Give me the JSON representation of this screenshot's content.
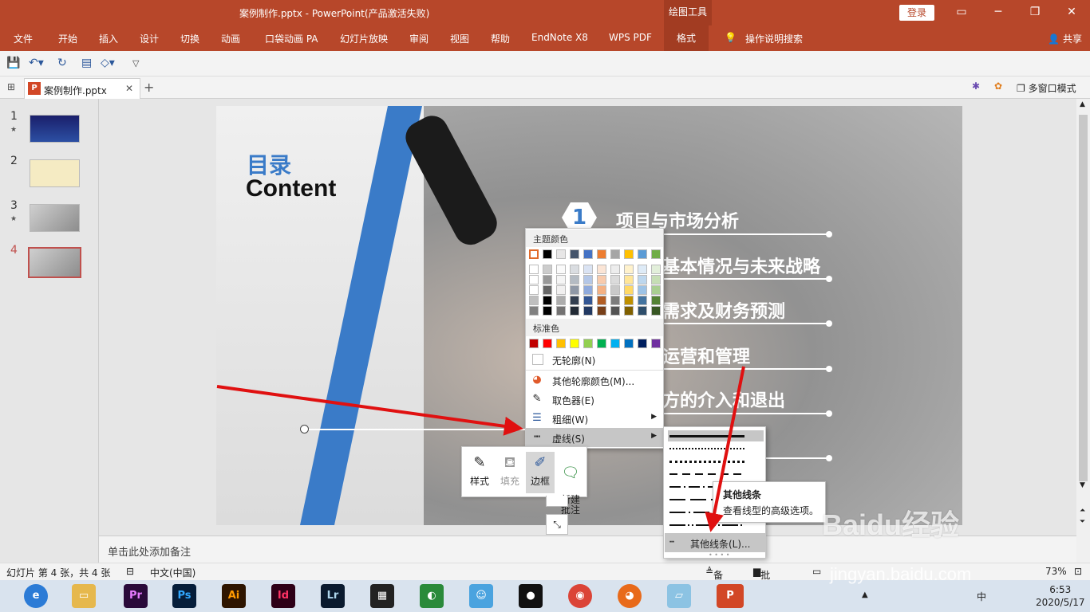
{
  "window": {
    "title": "案例制作.pptx  -  PowerPoint(产品激活失败)",
    "context_tab": "绘图工具",
    "login": "登录",
    "min_icon": "minimize-icon",
    "max_icon": "restore-icon",
    "close_icon": "close-icon"
  },
  "ribbon": {
    "tabs": [
      "文件",
      "开始",
      "插入",
      "设计",
      "切换",
      "动画",
      "口袋动画 PA",
      "幻灯片放映",
      "审阅",
      "视图",
      "帮助",
      "EndNote X8",
      "WPS PDF",
      "格式"
    ],
    "active_tab": "格式",
    "search": "操作说明搜索",
    "share": "共享"
  },
  "doc": {
    "tab_name": "案例制作.pptx",
    "multiwindow": "多窗口模式"
  },
  "thumbnails": [
    {
      "num": "1",
      "star": "★"
    },
    {
      "num": "2",
      "star": ""
    },
    {
      "num": "3",
      "star": "★"
    },
    {
      "num": "4",
      "star": ""
    }
  ],
  "slide": {
    "title_cn": "目录",
    "title_en": "Content",
    "badge_number": "1",
    "items": [
      "项目与市场分析",
      "基本情况与未来战略",
      "需求及财务预测",
      "运营和管理",
      "方的介入和退出"
    ]
  },
  "menu": {
    "theme_header": "主题颜色",
    "std_header": "标准色",
    "theme_top": [
      "#ffffff",
      "#000000",
      "#e7e6e6",
      "#44546a",
      "#4472c4",
      "#ed7d31",
      "#a5a5a5",
      "#ffc000",
      "#5b9bd5",
      "#70ad47"
    ],
    "standard": [
      "#c00000",
      "#ff0000",
      "#ffc000",
      "#ffff00",
      "#92d050",
      "#00b050",
      "#00b0f0",
      "#0070c0",
      "#002060",
      "#7030a0"
    ],
    "items": [
      {
        "label": "无轮廓(N)",
        "icon": "no-outline-icon"
      },
      {
        "label": "其他轮廓颜色(M)...",
        "icon": "color-wheel-icon"
      },
      {
        "label": "取色器(E)",
        "icon": "eyedropper-icon"
      },
      {
        "label": "粗细(W)",
        "icon": "weight-icon"
      },
      {
        "label": "虚线(S)",
        "icon": "dash-icon"
      }
    ]
  },
  "minitoolbar": {
    "style": "样式",
    "fill": "填充",
    "border": "边框",
    "comment": "新建\n批注"
  },
  "submenu": {
    "more": "其他线条(L)..."
  },
  "tooltip": {
    "title": "其他线条",
    "desc": "查看线型的高级选项。"
  },
  "notes": {
    "placeholder": "单击此处添加备注"
  },
  "status": {
    "slide_info": "幻灯片 第 4 张，共 4 张",
    "lang": "中文(中国)",
    "notes": "备注",
    "comments": "批注",
    "zoom": "73%"
  },
  "taskbar": {
    "apps": [
      "Pr",
      "Ps",
      "Ai",
      "Id",
      "Lr"
    ],
    "time": "6:53",
    "date": "2020/5/17",
    "ime": "中"
  },
  "watermark": {
    "text": "Baidu经验",
    "url": "jingyan.baidu.com"
  }
}
